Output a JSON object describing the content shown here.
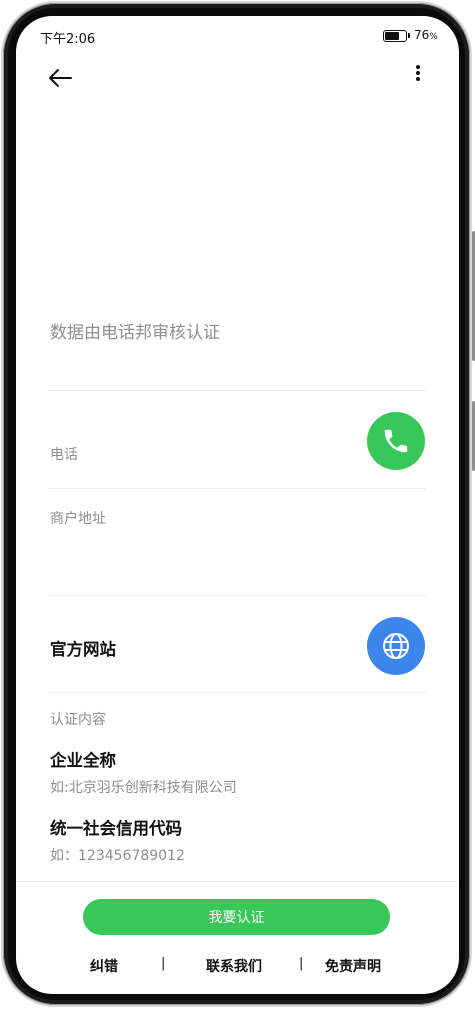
{
  "status_bar": {
    "time": "下午2:06",
    "battery_percent": "76",
    "battery_unit": "%",
    "battery_level": 0.76
  },
  "header": {
    "back_icon": "arrow-left-icon",
    "more_icon": "more-vertical-icon"
  },
  "verify_title": "数据由电话邦审核认证",
  "phone_section": {
    "label": "电话",
    "icon": "phone-icon",
    "button_color": "#38c759"
  },
  "address_section": {
    "label": "商户地址"
  },
  "website_section": {
    "label": "官方网站",
    "icon": "globe-icon",
    "button_color": "#3b86ea"
  },
  "certification": {
    "heading": "认证内容",
    "company_label": "企业全称",
    "company_placeholder": "如:北京羽乐创新科技有限公司",
    "credit_label": "统一社会信用代码",
    "credit_placeholder": "如：123456789012"
  },
  "cta": {
    "label": "我要认证",
    "color": "#38c759"
  },
  "footer": {
    "links": [
      "纠错",
      "联系我们",
      "免责声明"
    ],
    "separator": "|"
  }
}
